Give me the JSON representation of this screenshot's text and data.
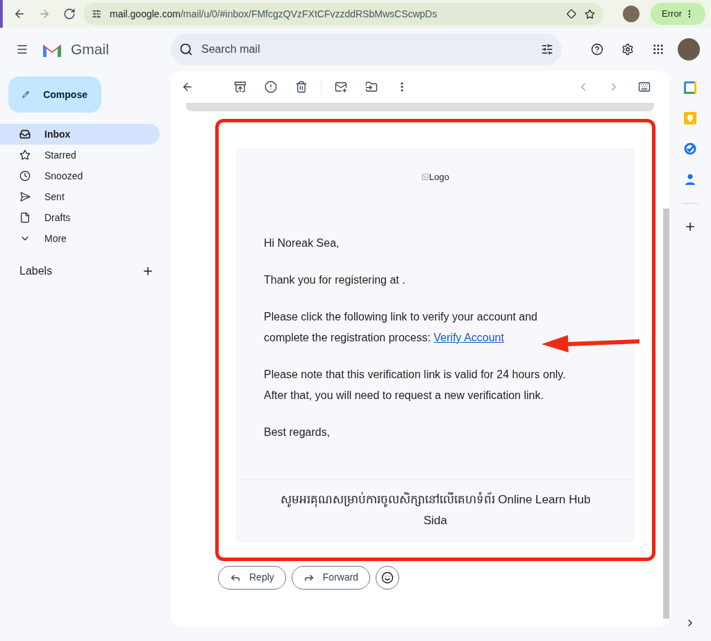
{
  "browser": {
    "url_host": "mail.google.com",
    "url_path": "/mail/u/0/#inbox/FMfcgzQVzFXtCFvzzddRSbMwsCScwpDs",
    "profile_button": "Error"
  },
  "header": {
    "app_name": "Gmail",
    "search": {
      "placeholder": "Search mail"
    }
  },
  "compose": "Compose",
  "nav": [
    {
      "label": "Inbox",
      "selected": true
    },
    {
      "label": "Starred",
      "selected": false
    },
    {
      "label": "Snoozed",
      "selected": false
    },
    {
      "label": "Sent",
      "selected": false
    },
    {
      "label": "Drafts",
      "selected": false
    },
    {
      "label": "More",
      "selected": false
    }
  ],
  "labels_heading": "Labels",
  "email": {
    "logo_alt": "Logo",
    "greeting": "Hi Noreak Sea,",
    "paragraphs": [
      {
        "text": "Thank you for registering at ."
      },
      {
        "text": "Please click the following link to verify your account and complete the registration process: ",
        "link": "Verify Account"
      },
      {
        "text": "Please note that this verification link is valid for 24 hours only. After that, you will need to request a new verification link."
      },
      {
        "text": "Best regards,"
      }
    ],
    "footer": [
      "សូមអរគុណសម្រាប់ការចូលសិក្សានៅលើគេហទំព័រ Online Learn Hub",
      "Sida"
    ]
  },
  "actions": [
    "Reply",
    "Forward"
  ]
}
